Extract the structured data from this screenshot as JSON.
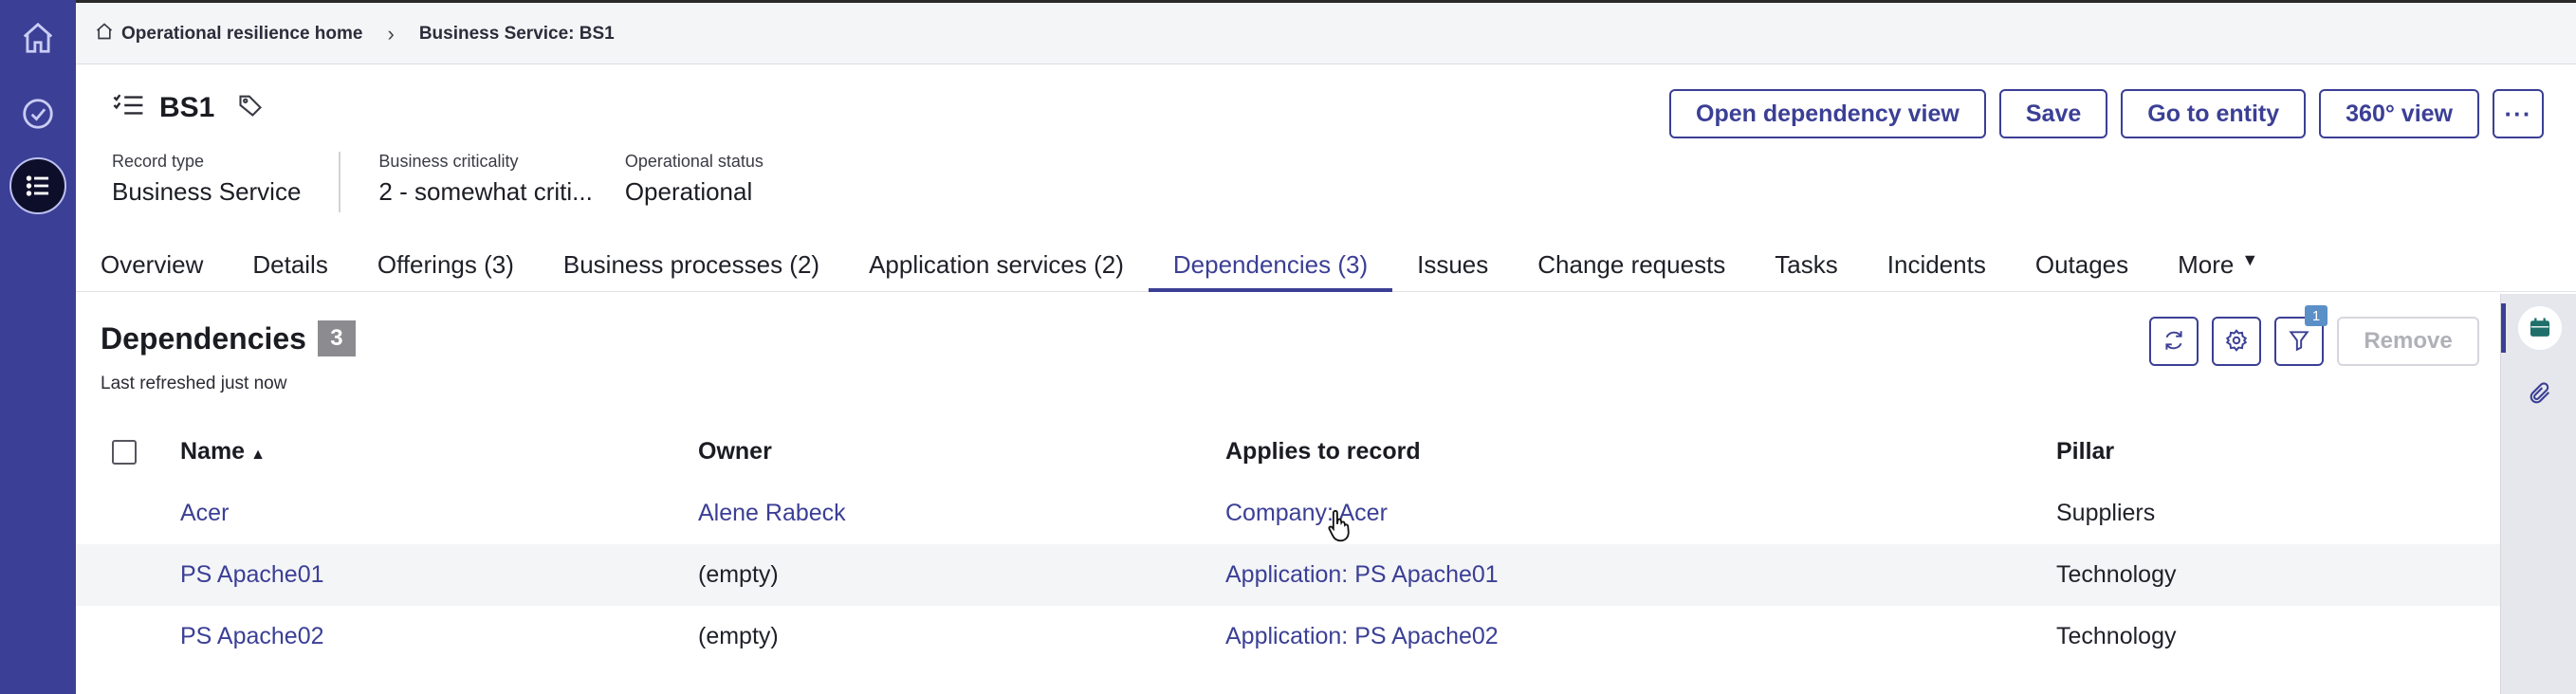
{
  "rail": {
    "items": [
      {
        "name": "home-icon"
      },
      {
        "name": "check-circle-icon"
      },
      {
        "name": "list-icon",
        "active": true
      }
    ]
  },
  "breadcrumb": {
    "home": "Operational resilience home",
    "current": "Business Service: BS1"
  },
  "header": {
    "title": "BS1",
    "meta": [
      {
        "label": "Record type",
        "value": "Business Service"
      },
      {
        "label": "Business criticality",
        "value": "2 - somewhat criti..."
      },
      {
        "label": "Operational status",
        "value": "Operational"
      }
    ],
    "actions": {
      "open_dependency_view": "Open dependency view",
      "save": "Save",
      "go_to_entity": "Go to entity",
      "view_360": "360° view",
      "more": "···"
    }
  },
  "tabs": [
    {
      "label": "Overview"
    },
    {
      "label": "Details"
    },
    {
      "label": "Offerings (3)"
    },
    {
      "label": "Business processes (2)"
    },
    {
      "label": "Application services (2)"
    },
    {
      "label": "Dependencies (3)",
      "active": true
    },
    {
      "label": "Issues"
    },
    {
      "label": "Change requests"
    },
    {
      "label": "Tasks"
    },
    {
      "label": "Incidents"
    },
    {
      "label": "Outages"
    },
    {
      "label": "More"
    }
  ],
  "list": {
    "title": "Dependencies",
    "count": "3",
    "refreshed": "Last refreshed just now",
    "filter_count": "1",
    "remove_label": "Remove",
    "columns": {
      "name": "Name",
      "owner": "Owner",
      "applies": "Applies to record",
      "pillar": "Pillar"
    },
    "sort_indicator": "▲",
    "rows": [
      {
        "name": "Acer",
        "owner": "Alene Rabeck",
        "applies": "Company: Acer",
        "pillar": "Suppliers"
      },
      {
        "name": "PS Apache01",
        "owner": "(empty)",
        "applies": "Application: PS Apache01",
        "pillar": "Technology"
      },
      {
        "name": "PS Apache02",
        "owner": "(empty)",
        "applies": "Application: PS Apache02",
        "pillar": "Technology"
      }
    ]
  },
  "colors": {
    "accent": "#3b3f95",
    "rail": "#3b3f95",
    "link": "#3b3f95"
  }
}
